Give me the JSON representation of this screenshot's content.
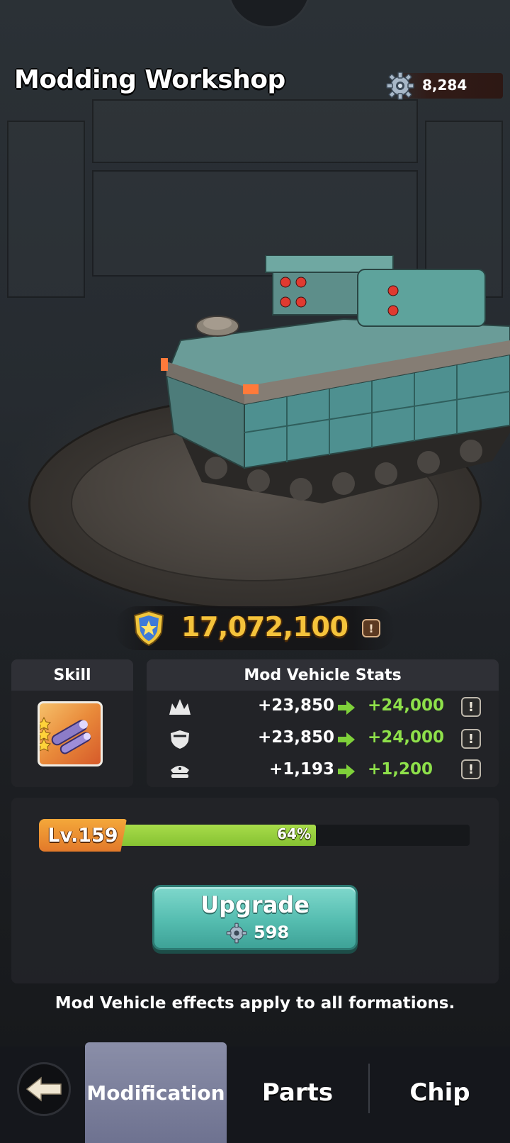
{
  "header": {
    "title": "Modding Workshop",
    "currency": {
      "icon": "gear-icon",
      "value": "8,284"
    }
  },
  "power": {
    "icon": "shield-star-icon",
    "value": "17,072,100",
    "info": "!"
  },
  "skill_panel": {
    "title": "Skill",
    "icon": "missile-skill-icon",
    "stars": 3
  },
  "stats_panel": {
    "title": "Mod Vehicle Stats",
    "rows": [
      {
        "icon": "attack-icon",
        "current": "+23,850",
        "next": "+24,000",
        "info": "!"
      },
      {
        "icon": "defense-icon",
        "current": "+23,850",
        "next": "+24,000",
        "info": "!"
      },
      {
        "icon": "hp-icon",
        "current": "+1,193",
        "next": "+1,200",
        "info": "!"
      }
    ]
  },
  "level": {
    "label": "Lv.159",
    "progress_label": "64%",
    "progress": 0.64
  },
  "upgrade": {
    "label": "Upgrade",
    "cost_icon": "gear-icon",
    "cost": "598"
  },
  "footnote": "Mod Vehicle effects apply to all formations.",
  "nav": {
    "back_icon": "back-arrow-icon",
    "tabs": [
      {
        "label": "Modification",
        "active": true
      },
      {
        "label": "Parts",
        "active": false
      },
      {
        "label": "Chip",
        "active": false
      }
    ]
  },
  "colors": {
    "gold": "#f5c33b",
    "green_value": "#8ee04a",
    "upgrade_teal": "#55bdb0",
    "level_orange": "#e2792a",
    "active_tab": "#7a7e9c"
  }
}
